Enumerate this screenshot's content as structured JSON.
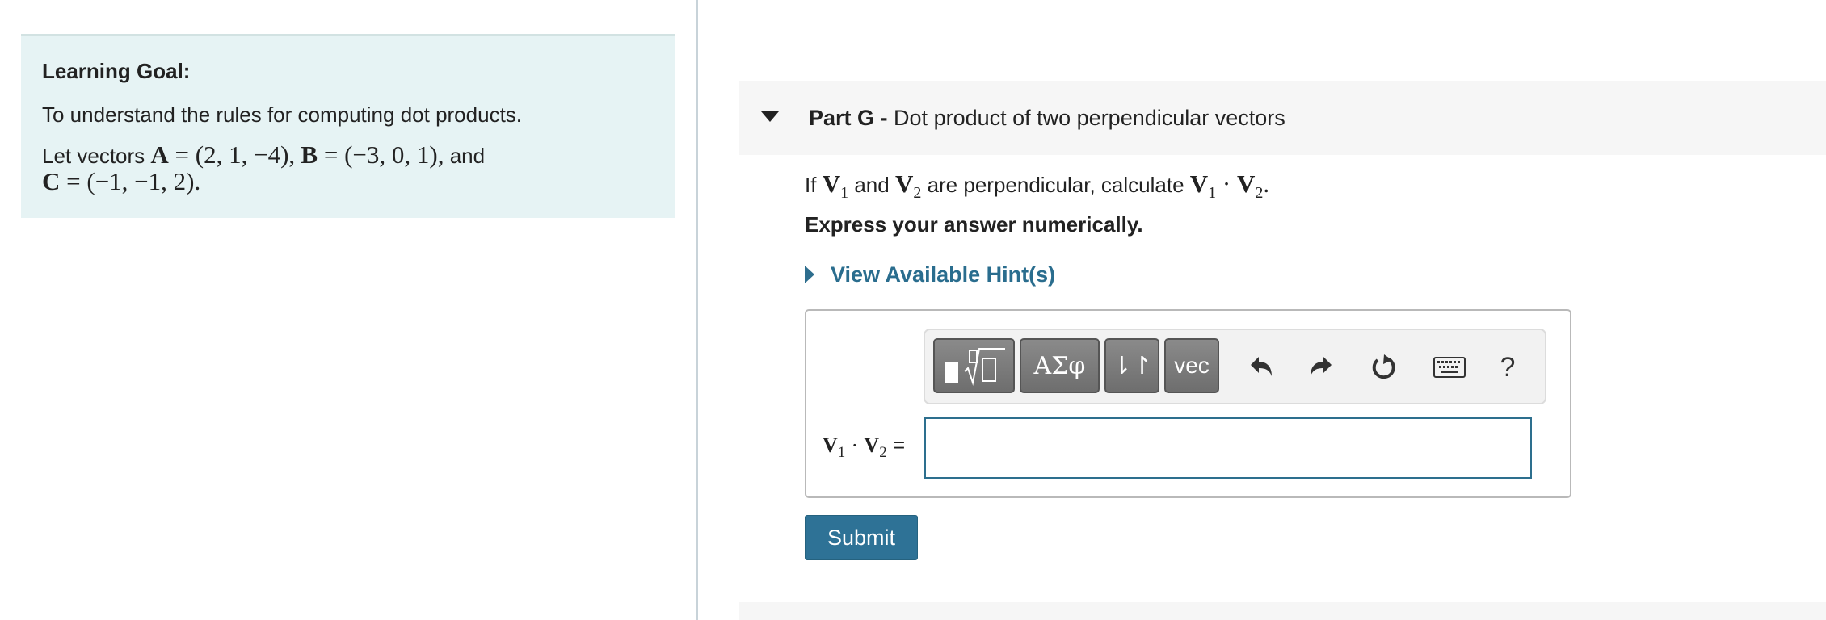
{
  "learning_goal": {
    "heading": "Learning Goal:",
    "text": "To understand the rules for computing dot products.",
    "vectors_intro": "Let vectors",
    "vector_a_name": "A",
    "vector_a_value": "(2, 1, −4)",
    "vector_b_name": "B",
    "vector_b_value": "(−3, 0, 1)",
    "and_word": "and",
    "vector_c_name": "C",
    "vector_c_value": "(−1, −1, 2)"
  },
  "part": {
    "label": "Part G -",
    "title": "Dot product of two perpendicular vectors",
    "question_if": "If",
    "v1_name": "V",
    "v1_sub": "1",
    "and_word": "and",
    "v2_name": "V",
    "v2_sub": "2",
    "question_mid": "are perpendicular, calculate",
    "instruction": "Express your answer numerically.",
    "hint_label": "View Available Hint(s)"
  },
  "toolbar": {
    "greek_label": "ΑΣφ",
    "arrows_label": "⇂↾",
    "vec_label": "vec",
    "help_label": "?",
    "icons": [
      "templates-icon",
      "undo-icon",
      "redo-icon",
      "reset-icon",
      "keyboard-icon"
    ]
  },
  "answer": {
    "value": "",
    "placeholder": "",
    "label_equals": "="
  },
  "submit_label": "Submit",
  "colors": {
    "goal_background": "#e6f3f4",
    "link_blue": "#2a6d8e",
    "submit_blue": "#2e7296",
    "input_border": "#2d6f8e"
  }
}
